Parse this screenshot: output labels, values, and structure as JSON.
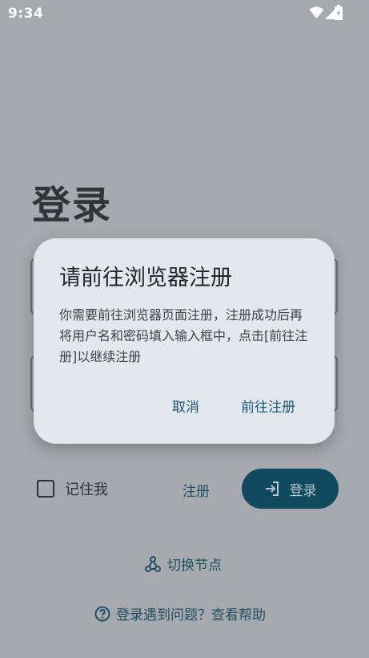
{
  "status_bar": {
    "time": "9:34"
  },
  "page": {
    "title": "登录"
  },
  "form": {
    "remember_label": "记住我",
    "register_link": "注册",
    "login_button": "登录",
    "switch_node": "切换节点",
    "help": "登录遇到问题？查看帮助"
  },
  "dialog": {
    "title": "请前往浏览器注册",
    "body": "你需要前往浏览器页面注册，注册成功后再将用户名和密码填入输入框中，点击[前往注册]以继续注册",
    "cancel": "取消",
    "confirm": "前往注册"
  },
  "colors": {
    "scrim_background": "#a6a9ad",
    "dialog_background": "#e3e8ef",
    "primary": "#0f4a5e",
    "link": "#1d5876"
  },
  "icons": {
    "status": [
      "wifi-icon",
      "signal-icon",
      "battery-icon"
    ],
    "login": "login-arrow-icon",
    "switch": "node-share-icon",
    "help": "help-circle-icon"
  }
}
